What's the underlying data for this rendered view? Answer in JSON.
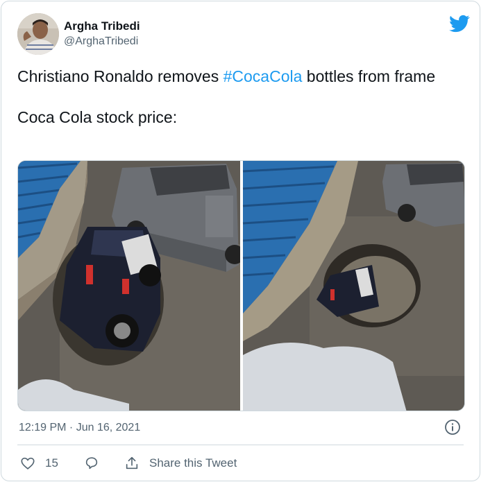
{
  "author": {
    "display_name": "Argha Tribedi",
    "handle": "@ArghaTribedi"
  },
  "tweet": {
    "text_before_hashtag": "Christiano Ronaldo removes ",
    "hashtag": "#CocaCola",
    "text_after_hashtag": " bottles from frame",
    "second_paragraph": "Coca Cola stock price:"
  },
  "meta": {
    "timestamp": "12:19 PM · Jun 16, 2021"
  },
  "actions": {
    "like_count": "15",
    "share_label": "Share this Tweet"
  },
  "colors": {
    "accent": "#1d9bf0",
    "text": "#0f1419",
    "secondary": "#536471",
    "border": "#cfd9de"
  },
  "icons": {
    "brand": "twitter-bird-icon",
    "info": "info-icon",
    "like": "heart-icon",
    "reply": "speech-bubble-icon",
    "share": "share-upload-icon"
  }
}
